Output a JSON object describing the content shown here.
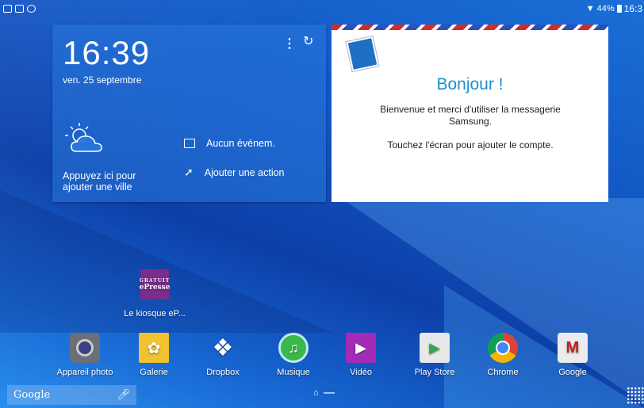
{
  "statusbar": {
    "battery": "44%",
    "time": "16:3"
  },
  "clock": {
    "time": "16:39",
    "date": "ven. 25 septembre",
    "city_prompt": "Appuyez ici pour ajouter une ville",
    "calendar_text": "Aucun événem.",
    "action_text": "Ajouter une action"
  },
  "mail": {
    "title": "Bonjour !",
    "message": "Bienvenue et merci d'utiliser la messagerie Samsung.",
    "hint": "Touchez l'écran pour ajouter le compte."
  },
  "epresse": {
    "badge_top": "GRATUIT",
    "badge_name": "ePresse",
    "label": "Le kiosque eP..."
  },
  "dock": [
    {
      "label": "Appareil photo",
      "icon": "camera-icon"
    },
    {
      "label": "Galerie",
      "icon": "gallery-icon"
    },
    {
      "label": "Dropbox",
      "icon": "dropbox-icon"
    },
    {
      "label": "Musique",
      "icon": "music-icon"
    },
    {
      "label": "Vidéo",
      "icon": "video-icon"
    },
    {
      "label": "Play Store",
      "icon": "playstore-icon"
    },
    {
      "label": "Chrome",
      "icon": "chrome-icon"
    },
    {
      "label": "Google",
      "icon": "google-folder-icon"
    }
  ],
  "search": {
    "logo": "Google"
  },
  "colors": {
    "mail_title": "#1a8fd0",
    "epresse": "#7a2d8c"
  }
}
